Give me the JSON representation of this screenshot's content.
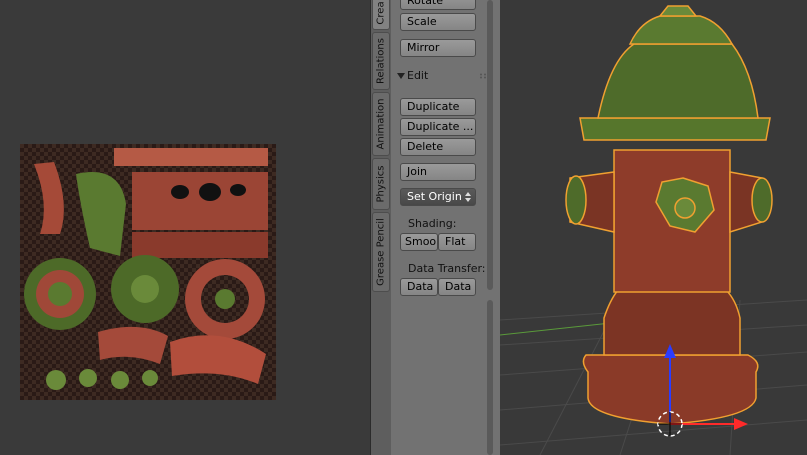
{
  "tool_shelf": {
    "tabs": [
      "Crea",
      "Relations",
      "Animation",
      "Physics",
      "Grease Pencil"
    ],
    "buttons": {
      "rotate": "Rotate",
      "scale": "Scale",
      "mirror": "Mirror",
      "duplicate": "Duplicate",
      "duplicate_linked": "Duplicate ...",
      "delete": "Delete",
      "join": "Join",
      "set_origin": "Set Origin",
      "smooth": "Smoo",
      "flat": "Flat",
      "data_1": "Data",
      "data_2": "Data"
    },
    "edit_panel_title": "Edit",
    "shading_label": "Shading:",
    "data_transfer_label": "Data Transfer:"
  },
  "icons": [
    "triangle-down-icon",
    "drag-handle-icon",
    "updown-arrows-icon",
    "3d-cursor-icon",
    "z-axis-arrow-icon",
    "x-axis-arrow-icon"
  ],
  "colors": {
    "shelf_bg": "#727272",
    "viewport_bg": "#393939",
    "hydrant_red": "#8a3a28",
    "hydrant_green": "#4e6b2a",
    "selection_outline": "#f0a030"
  }
}
